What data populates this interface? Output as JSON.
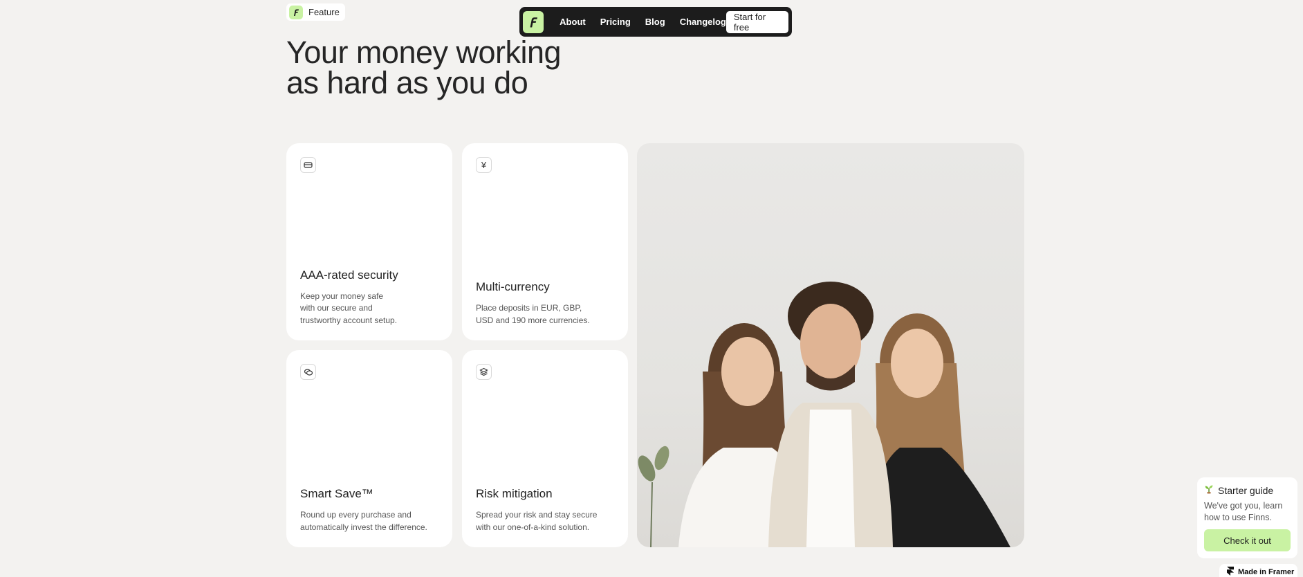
{
  "badge": {
    "label": "Feature"
  },
  "nav": {
    "links": [
      "About",
      "Pricing",
      "Blog",
      "Changelog"
    ],
    "cta": "Start for free"
  },
  "headline": {
    "line1": "Your money working",
    "line2": "as hard as you do"
  },
  "cards": [
    {
      "icon": "card-icon",
      "title": "AAA-rated security",
      "desc_lines": [
        "Keep your money safe",
        "with our secure and",
        "trustworthy account setup."
      ]
    },
    {
      "icon": "yen-icon",
      "icon_glyph": "¥",
      "title": "Multi-currency",
      "desc_lines": [
        "Place deposits in EUR, GBP,",
        "USD and 190 more currencies."
      ]
    },
    {
      "icon": "coins-icon",
      "title": "Smart Save™",
      "desc_lines": [
        "Round up every purchase and",
        "automatically invest the difference."
      ]
    },
    {
      "icon": "layers-icon",
      "title": "Risk mitigation",
      "desc_lines": [
        "Spread your risk and stay secure",
        "with our one-of-a-kind solution."
      ]
    }
  ],
  "starter": {
    "title": "Starter guide",
    "desc_lines": [
      "We've got you, learn",
      "how to use Finns."
    ],
    "button": "Check it out"
  },
  "framer_badge": "Made in Framer",
  "colors": {
    "accent": "#c9f2a3",
    "nav_bg": "#1c1c1c",
    "page_bg": "#f3f2f0"
  }
}
